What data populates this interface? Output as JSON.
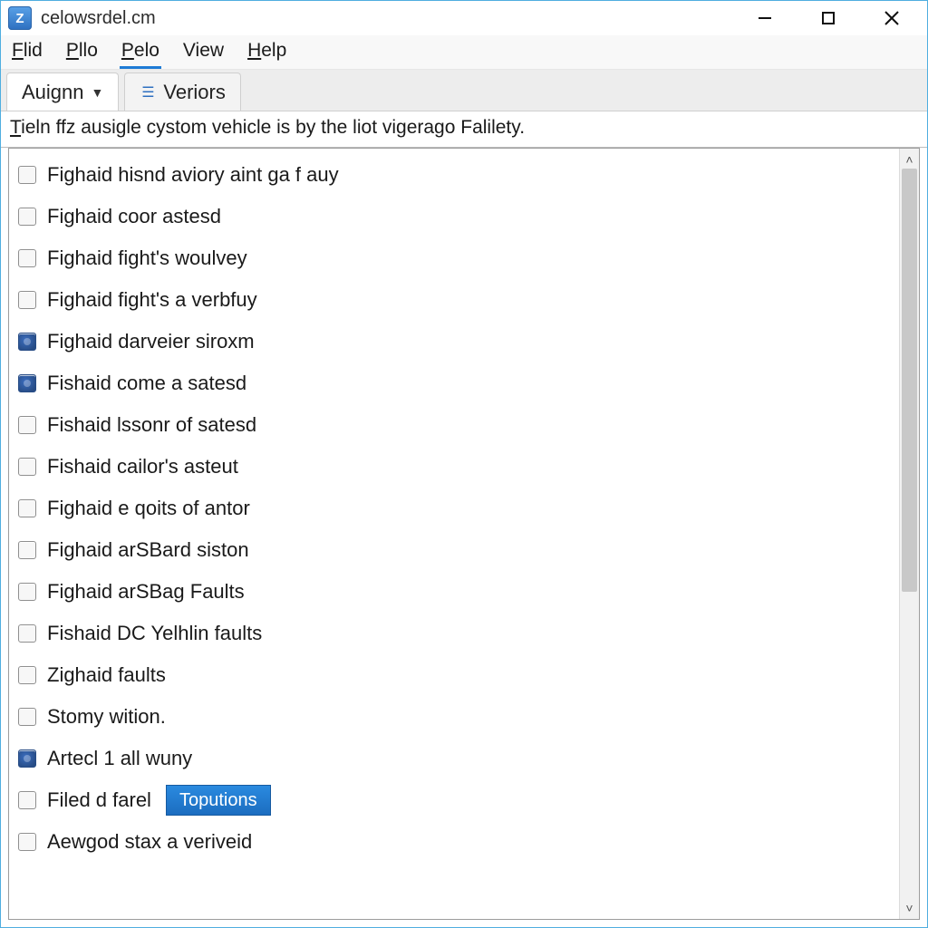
{
  "titlebar": {
    "title": "celowsrdel.cm",
    "icon_glyph": "Z"
  },
  "menubar": {
    "items": [
      {
        "label": "Flid",
        "underline": "F"
      },
      {
        "label": "Pllo",
        "underline": "P"
      },
      {
        "label": "Pelo",
        "underline": "P",
        "active": true
      },
      {
        "label": "View"
      },
      {
        "label": "Help",
        "underline": "H"
      }
    ]
  },
  "tabs": [
    {
      "label": "Auignn",
      "has_caret": true
    },
    {
      "label": "Veriors",
      "has_icon": true
    }
  ],
  "description": {
    "prefix_underline": "T",
    "text": "ieln ffz ausigle cystom vehicle is by the liot vigerago Falilety."
  },
  "list_items": [
    {
      "label": "Fighaid hisnd aviory aint ga f auy",
      "checked": false
    },
    {
      "label": "Fighaid coor astesd",
      "checked": false
    },
    {
      "label": "Fighaid fight's woulvey",
      "checked": false
    },
    {
      "label": "Fighaid fight's a verbfuy",
      "checked": false
    },
    {
      "label": "Fighaid darveier siroxm",
      "checked": true
    },
    {
      "label": "Fishaid come a satesd",
      "checked": true
    },
    {
      "label": "Fishaid lssonr of satesd",
      "checked": false
    },
    {
      "label": "Fishaid cailor's asteut",
      "checked": false
    },
    {
      "label": "Fighaid e qoits of antor",
      "checked": false
    },
    {
      "label": "Fighaid arSBard siston",
      "checked": false
    },
    {
      "label": "Fighaid arSBag Faults",
      "checked": false
    },
    {
      "label": "Fishaid DC Yelhlin faults",
      "checked": false
    },
    {
      "label": "Zighaid faults",
      "checked": false
    },
    {
      "label": "Stomy wition.",
      "checked": false
    },
    {
      "label": "Artecl 1 all wuny",
      "checked": true
    },
    {
      "label": "Filed d farel",
      "checked": false,
      "button": "Toputions"
    },
    {
      "label": "Aewgod stax a veriveid",
      "checked": false
    }
  ]
}
